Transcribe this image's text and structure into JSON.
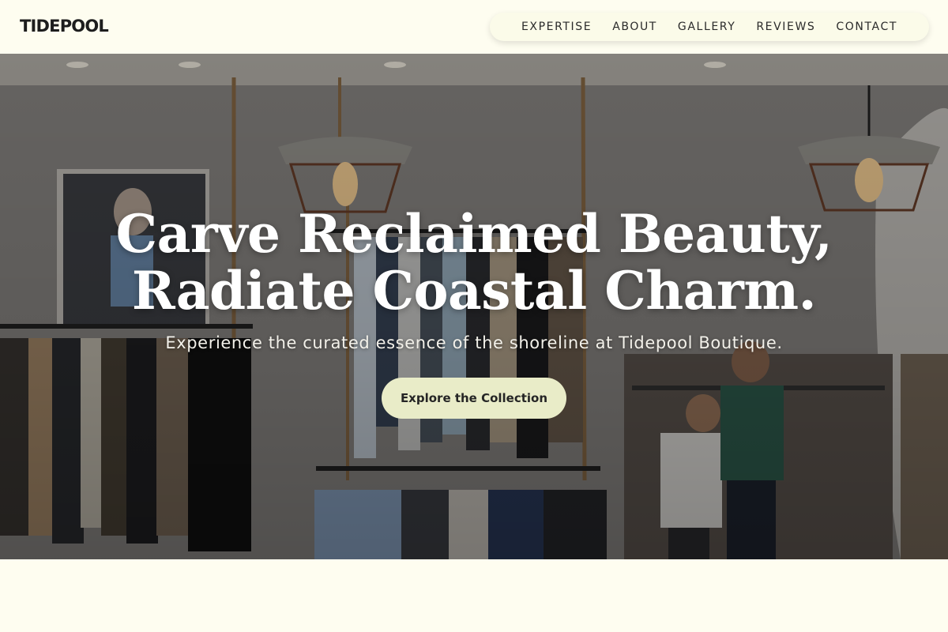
{
  "brand": {
    "logo_text": "TIDEPOOL"
  },
  "nav": {
    "items": [
      {
        "label": "EXPERTISE"
      },
      {
        "label": "ABOUT"
      },
      {
        "label": "GALLERY"
      },
      {
        "label": "REVIEWS"
      },
      {
        "label": "CONTACT"
      }
    ]
  },
  "hero": {
    "headline_line1": "Carve Reclaimed Beauty,",
    "headline_line2": "Radiate Coastal Charm.",
    "subheadline": "Experience the curated essence of the shoreline at Tidepool Boutique.",
    "cta_label": "Explore the Collection"
  },
  "colors": {
    "page_background": "#fefdf0",
    "nav_pill": "#fbfbe9",
    "cta_background": "#e9ecc8",
    "text_dark": "#1d1d1d",
    "hero_text": "#ffffff"
  }
}
